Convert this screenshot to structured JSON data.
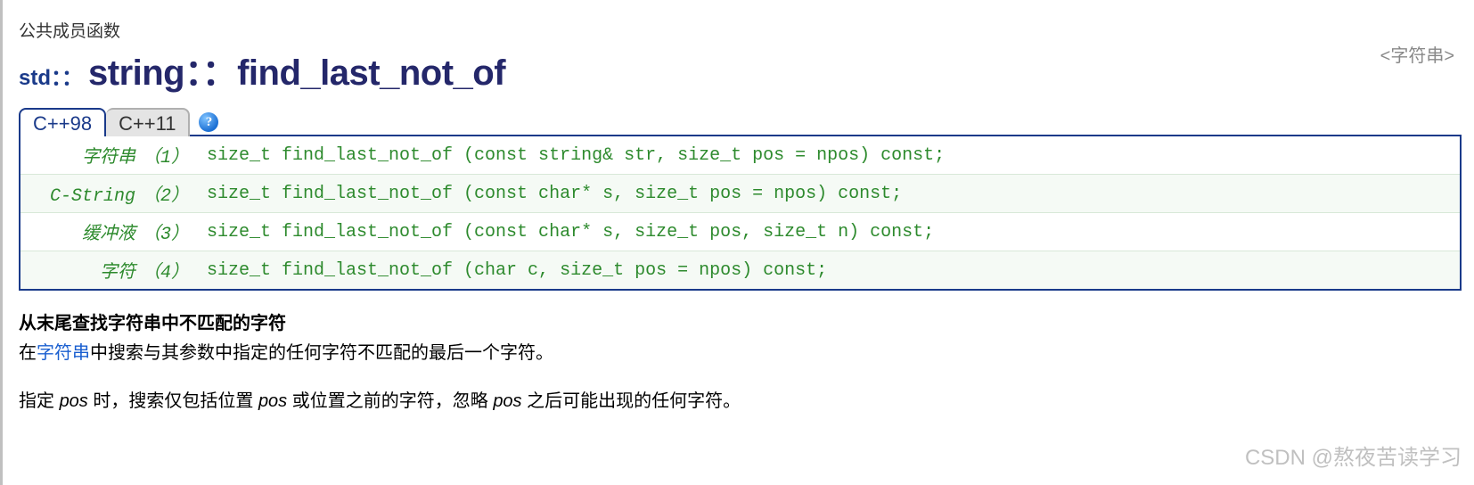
{
  "category": "公共成员函数",
  "namespace": "std：：",
  "functionName": "string：：find_last_not_of",
  "headerTag": "<字符串>",
  "tabs": {
    "active": "C++98",
    "inactive": "C++11"
  },
  "helpGlyph": "?",
  "signatures": [
    {
      "label": "字符串",
      "idx": "（1）",
      "code": "size_t find_last_not_of (const string& str, size_t pos = npos) const;"
    },
    {
      "label": "C-String",
      "idx": "（2）",
      "code": "size_t find_last_not_of (const char* s, size_t pos = npos) const;"
    },
    {
      "label": "缓冲液",
      "idx": "（3）",
      "code": "size_t find_last_not_of (const char* s, size_t pos, size_t n) const;"
    },
    {
      "label": "字符",
      "idx": "（4）",
      "code": "size_t find_last_not_of (char c, size_t pos = npos) const;"
    }
  ],
  "section": {
    "title": "从末尾查找字符串中不匹配的字符",
    "p1_a": "在",
    "p1_link": "字符串",
    "p1_b": "中搜索与其参数中指定的任何字符不匹配的最后一个字符。",
    "p2_a": "指定 ",
    "p2_i1": "pos",
    "p2_b": " 时，搜索仅包括位置 ",
    "p2_i2": "pos",
    "p2_c": " 或位置之前的字符，忽略 ",
    "p2_i3": "pos",
    "p2_d": " 之后可能出现的任何字符。"
  },
  "watermark": "CSDN @熬夜苦读学习"
}
